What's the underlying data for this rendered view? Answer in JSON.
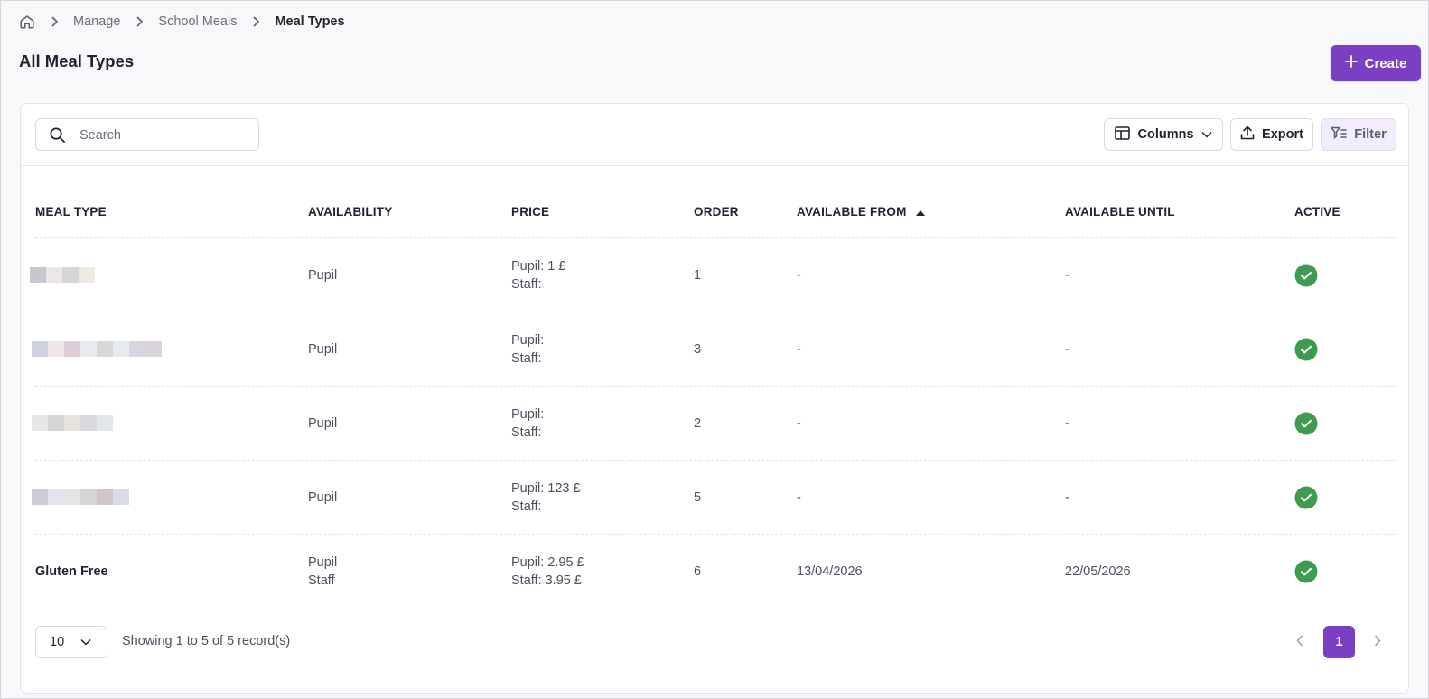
{
  "breadcrumb": {
    "home_icon": "home-icon",
    "items": [
      "Manage",
      "School Meals",
      "Meal Types"
    ]
  },
  "page": {
    "title": "All Meal Types",
    "create_label": "Create"
  },
  "toolbar": {
    "search_placeholder": "Search",
    "search_value": "",
    "columns_label": "Columns",
    "export_label": "Export",
    "filter_label": "Filter"
  },
  "table": {
    "headers": {
      "meal_type": "MEAL TYPE",
      "availability": "AVAILABILITY",
      "price": "PRICE",
      "order": "ORDER",
      "available_from": "AVAILABLE FROM",
      "available_until": "AVAILABLE UNTIL",
      "active": "ACTIVE"
    },
    "sort": {
      "column": "available_from",
      "direction": "ascending"
    },
    "rows": [
      {
        "name": "",
        "name_redacted": true,
        "availability": [
          "Pupil"
        ],
        "price": [
          "Pupil: 1 £",
          "Staff:"
        ],
        "order": "1",
        "available_from": "-",
        "available_until": "-",
        "active": true
      },
      {
        "name": "",
        "name_redacted": true,
        "availability": [
          "Pupil"
        ],
        "price": [
          "Pupil:",
          "Staff:"
        ],
        "order": "3",
        "available_from": "-",
        "available_until": "-",
        "active": true
      },
      {
        "name": "",
        "name_redacted": true,
        "availability": [
          "Pupil"
        ],
        "price": [
          "Pupil:",
          "Staff:"
        ],
        "order": "2",
        "available_from": "-",
        "available_until": "-",
        "active": true
      },
      {
        "name": "",
        "name_redacted": true,
        "availability": [
          "Pupil"
        ],
        "price": [
          "Pupil: 123 £",
          "Staff:"
        ],
        "order": "5",
        "available_from": "-",
        "available_until": "-",
        "active": true
      },
      {
        "name": "Gluten Free",
        "name_redacted": false,
        "availability": [
          "Pupil",
          "Staff"
        ],
        "price": [
          "Pupil: 2.95 £",
          "Staff: 3.95 £"
        ],
        "order": "6",
        "available_from": "13/04/2026",
        "available_until": "22/05/2026",
        "active": true
      }
    ]
  },
  "footer": {
    "page_size": "10",
    "showing_text": "Showing 1 to 5 of 5 record(s)",
    "current_page": "1"
  },
  "colors": {
    "accent": "#7a3fc2",
    "active_green": "#3f9b4f",
    "filter_bg": "#f3ecfb"
  }
}
